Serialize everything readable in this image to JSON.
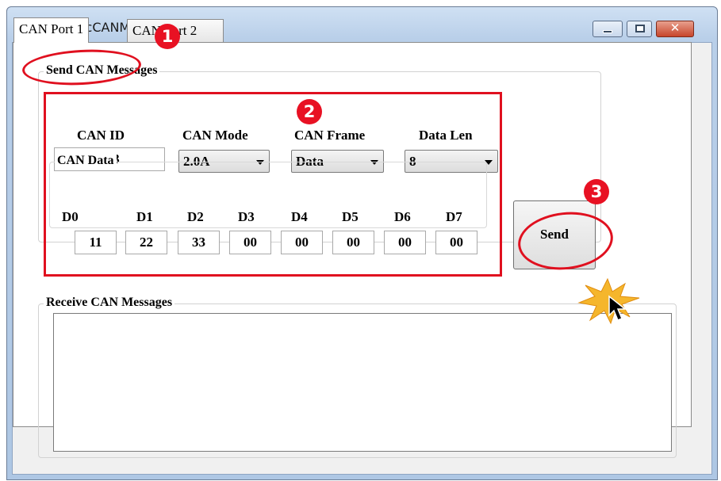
{
  "window": {
    "title": "SendRecCANM",
    "minimize_glyph": "",
    "maximize_glyph": "",
    "close_glyph": "✕"
  },
  "tabs": [
    {
      "label": "CAN Port 1",
      "selected": true
    },
    {
      "label": "CAN Port 2",
      "selected": false
    }
  ],
  "send_group": {
    "legend": "Send CAN Messages",
    "can_id": {
      "label": "CAN ID",
      "value": "123"
    },
    "can_mode": {
      "label": "CAN Mode",
      "value": "2.0A"
    },
    "can_frame": {
      "label": "CAN Frame",
      "value": "Data"
    },
    "data_len": {
      "label": "Data Len",
      "value": "8"
    },
    "can_data": {
      "legend": "CAN Data",
      "bytes": [
        {
          "label": "D0",
          "value": "11"
        },
        {
          "label": "D1",
          "value": "22"
        },
        {
          "label": "D2",
          "value": "33"
        },
        {
          "label": "D3",
          "value": "00"
        },
        {
          "label": "D4",
          "value": "00"
        },
        {
          "label": "D5",
          "value": "00"
        },
        {
          "label": "D6",
          "value": "00"
        },
        {
          "label": "D7",
          "value": "00"
        }
      ]
    }
  },
  "send_button": {
    "label": "Send"
  },
  "receive_group": {
    "legend": "Receive CAN Messages",
    "content": ""
  },
  "annotations": {
    "badge_1": "1",
    "badge_2": "2",
    "badge_3": "3",
    "highlight_color": "#e0101f"
  },
  "icons": {
    "app": "app-window-icon",
    "burst": "click-burst-icon",
    "cursor": "mouse-cursor-icon"
  }
}
